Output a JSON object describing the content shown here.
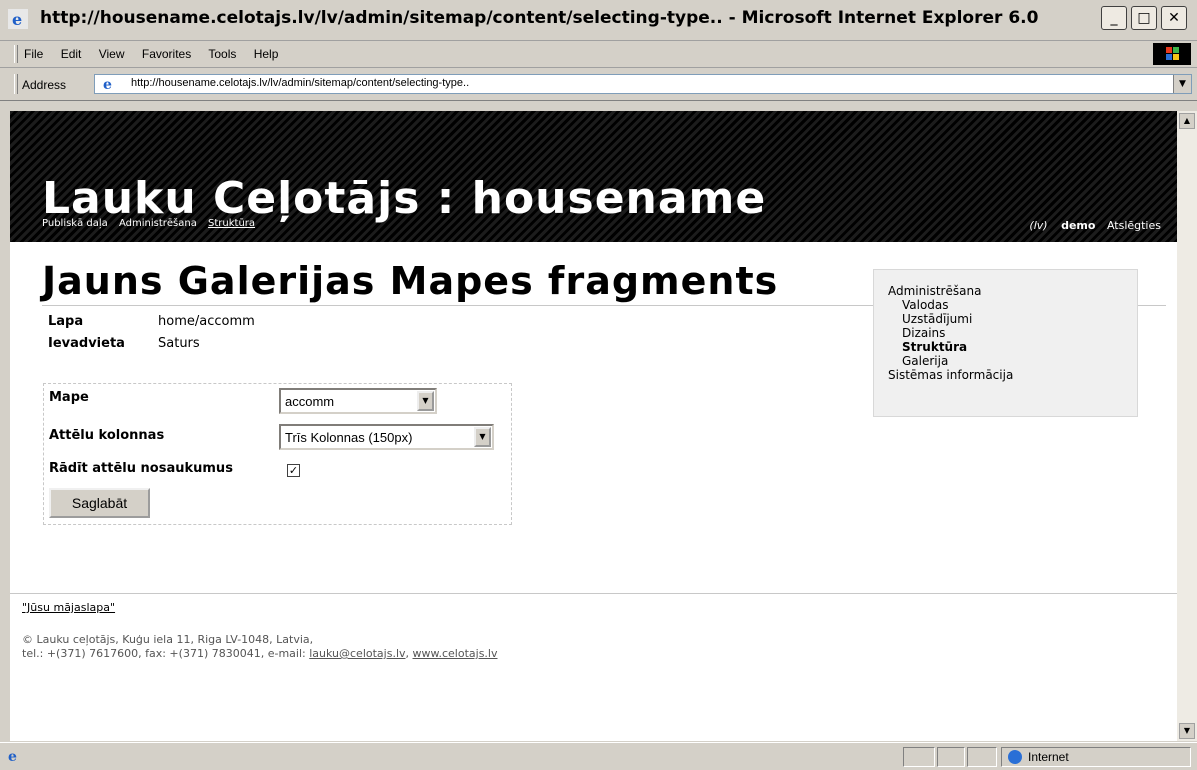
{
  "window": {
    "title": "http://housename.celotajs.lv/lv/admin/sitemap/content/selecting-type.. - Microsoft Internet Explorer 6.0",
    "buttons": {
      "minimize": "_",
      "maximize": "□",
      "close": "✕"
    }
  },
  "menu": {
    "items": [
      "File",
      "Edit",
      "View",
      "Favorites",
      "Tools",
      "Help"
    ]
  },
  "address": {
    "label": "Address",
    "url": "http://housename.celotajs.lv/lv/admin/sitemap/content/selecting-type.."
  },
  "header": {
    "site_title": "Lauku Ceļotājs : housename",
    "nav": [
      "Publiskā daļa",
      "Administrēšana",
      "Struktūra"
    ],
    "lang": "(lv)",
    "user": "demo",
    "logout": "Atslēgties"
  },
  "page": {
    "heading": "Jauns Galerijas Mapes fragments",
    "meta": [
      {
        "key": "Lapa",
        "value": "home/accomm"
      },
      {
        "key": "Ievadvieta",
        "value": "Saturs"
      }
    ]
  },
  "form": {
    "folder_label": "Mape",
    "folder_value": "accomm",
    "columns_label": "Attēlu kolonnas",
    "columns_value": "Trīs Kolonnas (150px)",
    "show_names_label": "Rādīt attēlu nosaukumus",
    "show_names_checked": true,
    "save_label": "Saglabāt"
  },
  "sidebar": {
    "title": "Administrēšana",
    "items": [
      "Valodas",
      "Uzstādījumi",
      "Dizains",
      "Struktūra",
      "Galerija"
    ],
    "active": "Struktūra",
    "bottom": "Sistēmas informācija"
  },
  "footer": {
    "home_link": "\"Jūsu mājaslapa\"",
    "line1": "© Lauku ceļotājs, Kuģu iela 11, Riga LV-1048, Latvia,",
    "line2_prefix": "tel.: +(371) 7617600, fax: +(371) 7830041, e-mail: ",
    "email": "lauku@celotajs.lv",
    "sep": ", ",
    "website": "www.celotajs.lv"
  },
  "status": {
    "zone": "Internet"
  }
}
